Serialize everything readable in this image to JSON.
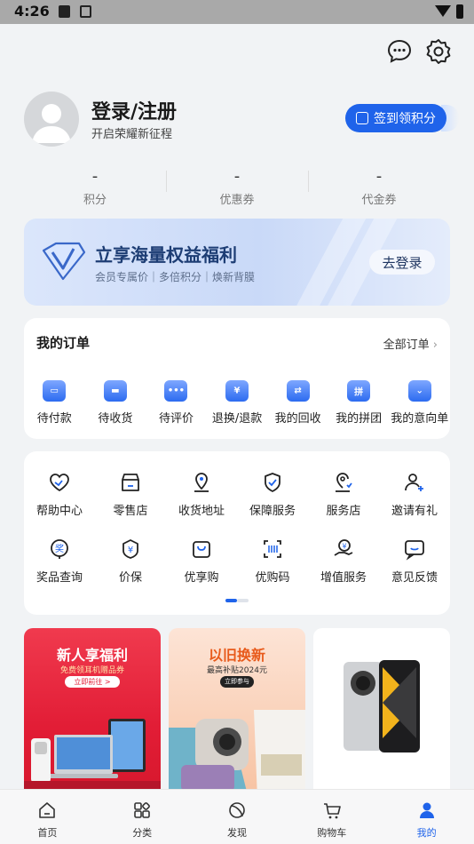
{
  "status_bar": {
    "time": "4:26"
  },
  "profile": {
    "login_title": "登录/注册",
    "subtitle": "开启荣耀新征程",
    "checkin_label": "签到领积分"
  },
  "stats": [
    {
      "value": "-",
      "label": "积分"
    },
    {
      "value": "-",
      "label": "优惠券"
    },
    {
      "value": "-",
      "label": "代金券"
    }
  ],
  "banner": {
    "title": "立享海量权益福利",
    "subtitle": "会员专属价｜多倍积分｜焕新背膜",
    "button": "去登录"
  },
  "orders": {
    "title": "我的订单",
    "all_label": "全部订单",
    "items": [
      {
        "label": "待付款",
        "icon": "wallet-icon"
      },
      {
        "label": "待收货",
        "icon": "truck-icon"
      },
      {
        "label": "待评价",
        "icon": "comment-icon"
      },
      {
        "label": "退换/退款",
        "icon": "refund-icon"
      },
      {
        "label": "我的回收",
        "icon": "recycle-icon"
      },
      {
        "label": "我的拼团",
        "icon": "group-buy-icon"
      },
      {
        "label": "我的意向单",
        "icon": "wishlist-icon"
      }
    ]
  },
  "services": {
    "row1": [
      {
        "label": "帮助中心",
        "icon": "help-heart-icon"
      },
      {
        "label": "零售店",
        "icon": "store-icon"
      },
      {
        "label": "收货地址",
        "icon": "location-icon"
      },
      {
        "label": "保障服务",
        "icon": "shield-icon"
      },
      {
        "label": "服务店",
        "icon": "service-store-icon"
      },
      {
        "label": "邀请有礼",
        "icon": "invite-icon"
      }
    ],
    "row2": [
      {
        "label": "奖品查询",
        "icon": "prize-icon"
      },
      {
        "label": "价保",
        "icon": "price-protect-icon"
      },
      {
        "label": "优享购",
        "icon": "shopping-bag-icon"
      },
      {
        "label": "优购码",
        "icon": "code-icon"
      },
      {
        "label": "增值服务",
        "icon": "value-added-icon"
      },
      {
        "label": "意见反馈",
        "icon": "feedback-icon"
      }
    ]
  },
  "promos": [
    {
      "title": "新人享福利",
      "subtitle": "免费领耳机赠品券",
      "button": "立即前往 >"
    },
    {
      "title": "以旧换新",
      "subtitle": "最高补贴2024元",
      "button": "立即参与"
    },
    {
      "title": "",
      "subtitle": "",
      "button": ""
    }
  ],
  "tabs": [
    {
      "label": "首页",
      "icon": "home-icon"
    },
    {
      "label": "分类",
      "icon": "category-icon"
    },
    {
      "label": "发现",
      "icon": "discover-icon"
    },
    {
      "label": "购物车",
      "icon": "cart-icon"
    },
    {
      "label": "我的",
      "icon": "user-icon",
      "active": true
    }
  ],
  "colors": {
    "accent": "#1f63ea",
    "background": "#f1f3f5",
    "promo_red": "#e21d36"
  }
}
